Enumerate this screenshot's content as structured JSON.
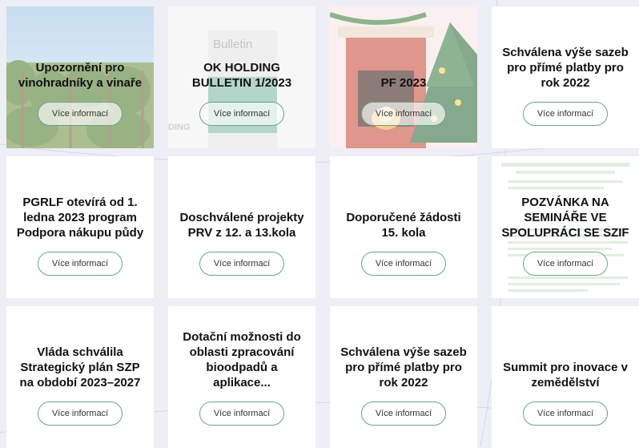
{
  "cards": [
    {
      "title": "Upozornění pro vinohradníky a vinaře",
      "button": "Více informací",
      "thumbnail": "vineyard-photo"
    },
    {
      "title": "OK HOLDING BULLETIN 1/2023",
      "button": "Více informací",
      "thumbnail": "bulletin-cover",
      "thumbnail_text_1": "Bulletin",
      "thumbnail_text_2": "DING"
    },
    {
      "title": "PF 2023",
      "button": "Více informací",
      "thumbnail": "christmas-fireplace-tree"
    },
    {
      "title": "Schválena výše sazeb pro přímé platby pro rok 2022",
      "button": "Více informací"
    },
    {
      "title": "PGRLF otevírá od 1. ledna 2023 program Podpora nákupu půdy",
      "button": "Více informací"
    },
    {
      "title": "Doschválené projekty PRV z 12. a 13.kola",
      "button": "Více informací"
    },
    {
      "title": "Doporučené žádosti 15. kola",
      "button": "Více informací"
    },
    {
      "title": "POZVÁNKA NA SEMINÁŘE VE SPOLUPRÁCI SE SZIF",
      "button": "Více informací",
      "thumbnail": "invitation-document"
    },
    {
      "title": "Vláda schválila Strategický plán SZP na období 2023–2027",
      "button": "Více informací"
    },
    {
      "title": "Dotační možnosti do oblasti zpracování bioodpadů a aplikace...",
      "button": "Více informací"
    },
    {
      "title": "Schválena výše sazeb pro přímé platby pro rok 2022",
      "button": "Více informací"
    },
    {
      "title": "Summit pro inovace v zemědělství",
      "button": "Více informací"
    }
  ],
  "colors": {
    "page_bg": "#eeeef6",
    "card_bg": "#ffffff",
    "button_border": "#6aa38b",
    "title_text": "#111111"
  }
}
